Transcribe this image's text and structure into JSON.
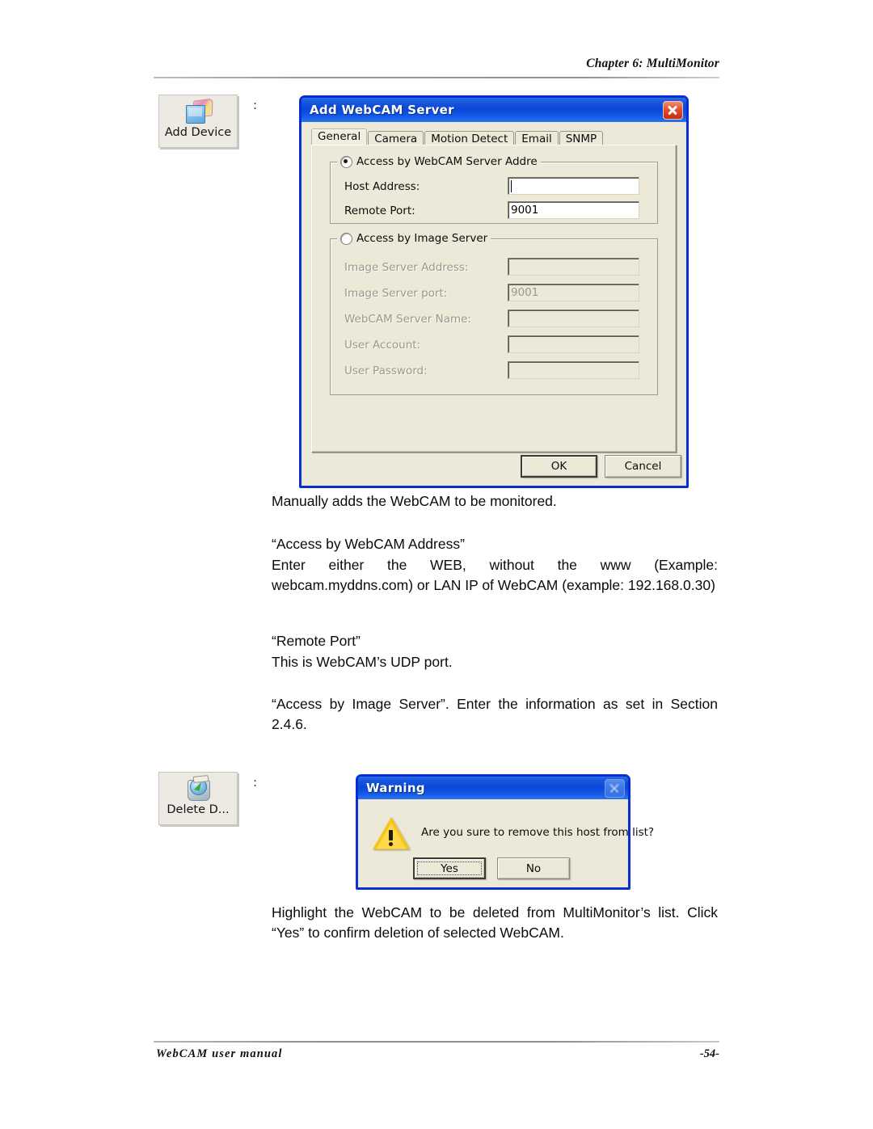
{
  "page": {
    "header_chapter": "Chapter 6: MultiMonitor",
    "footer_left": "WebCAM user manual",
    "footer_page": "-54-"
  },
  "toolbar": {
    "add_device": {
      "label": "Add Device",
      "icon": "add-device-icon",
      "colon": ":"
    },
    "delete_device": {
      "label": "Delete D...",
      "icon": "delete-device-icon",
      "colon": ":"
    }
  },
  "add_dialog": {
    "title": "Add WebCAM Server",
    "close_icon": "close-icon",
    "tabs": [
      {
        "label": "General",
        "active": true
      },
      {
        "label": "Camera",
        "active": false
      },
      {
        "label": "Motion Detect",
        "active": false
      },
      {
        "label": "Email",
        "active": false
      },
      {
        "label": "SNMP",
        "active": false
      }
    ],
    "group_webcam": {
      "legend": "Access by WebCAM Server Addre",
      "selected": true,
      "fields": [
        {
          "label": "Host Address:",
          "value": ""
        },
        {
          "label": "Remote Port:",
          "value": "9001"
        }
      ]
    },
    "group_image": {
      "legend": "Access by Image Server",
      "selected": false,
      "fields": [
        {
          "label": "Image Server Address:",
          "value": ""
        },
        {
          "label": "Image Server port:",
          "value": "9001"
        },
        {
          "label": "WebCAM Server Name:",
          "value": ""
        },
        {
          "label": "User Account:",
          "value": ""
        },
        {
          "label": "User Password:",
          "value": ""
        }
      ]
    },
    "buttons": {
      "ok": "OK",
      "cancel": "Cancel"
    }
  },
  "warning_dialog": {
    "title": "Warning",
    "close_icon": "close-icon",
    "message": "Are you sure to remove this host from list?",
    "icon": "warning-triangle-icon",
    "buttons": {
      "yes": "Yes",
      "no": "No"
    }
  },
  "body": {
    "p1": "Manually adds the WebCAM to be monitored.",
    "p2": "“Access by WebCAM Address”",
    "p3": "Enter either the WEB, without the www (Example: webcam.myddns.com) or LAN IP of WebCAM (example: 192.168.0.30)",
    "p4": "“Remote Port”",
    "p5": "This is WebCAM’s UDP port.",
    "p6": "“Access by Image Server”. Enter the information as set in Section 2.4.6.",
    "p7": "Highlight the WebCAM to be deleted from MultiMonitor’s list. Click “Yes” to confirm deletion of selected WebCAM."
  },
  "colors": {
    "title_blue": "#0a47d8",
    "dialog_face": "#ece9d8",
    "close_red": "#e04a2a",
    "warning_yellow": "#f5c518"
  }
}
